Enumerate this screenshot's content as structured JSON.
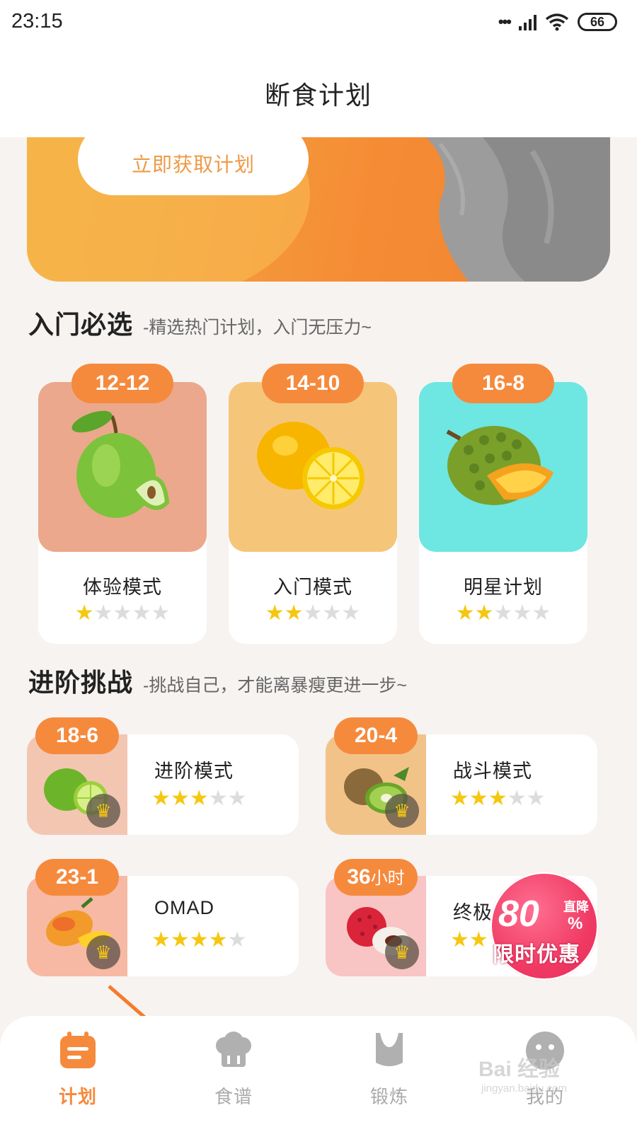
{
  "status_bar": {
    "time": "23:15",
    "battery": "66",
    "signal_dots": "•••"
  },
  "header": {
    "title": "断食计划"
  },
  "banner": {
    "button_label": "立即获取计划"
  },
  "beginner": {
    "title": "入门必选",
    "subtitle": "-精选热门计划，入门无压力~",
    "cards": [
      {
        "badge": "12-12",
        "label": "体验模式",
        "rating": 1,
        "max_rating": 5,
        "fruit": "green-apple",
        "bg": "#eba88c"
      },
      {
        "badge": "14-10",
        "label": "入门模式",
        "rating": 2,
        "max_rating": 5,
        "fruit": "lemon",
        "bg": "#f5c67a"
      },
      {
        "badge": "16-8",
        "label": "明星计划",
        "rating": 2,
        "max_rating": 5,
        "fruit": "durian",
        "bg": "#6ee6e2"
      }
    ]
  },
  "advanced": {
    "title": "进阶挑战",
    "subtitle": "-挑战自己，才能离暴瘦更进一步~",
    "cards": [
      {
        "badge": "18-6",
        "label": "进阶模式",
        "rating": 3,
        "max_rating": 5,
        "fruit": "lime",
        "bg": "#f3c6b2"
      },
      {
        "badge": "20-4",
        "label": "战斗模式",
        "rating": 3,
        "max_rating": 5,
        "fruit": "kiwi",
        "bg": "#f2c389"
      },
      {
        "badge": "23-1",
        "label": "OMAD",
        "rating": 4,
        "max_rating": 5,
        "fruit": "mango",
        "bg": "#f7b9a3"
      },
      {
        "badge_main": "36",
        "badge_unit": "小时",
        "label": "终极",
        "rating": 2,
        "max_rating": 5,
        "fruit": "lychee",
        "bg": "#f9c4c4"
      }
    ]
  },
  "promo": {
    "amount": "80",
    "tag": "直降",
    "unit": "%",
    "label": "限时优惠"
  },
  "tabbar": {
    "tabs": [
      {
        "label": "计划",
        "icon": "calendar-icon",
        "active": true
      },
      {
        "label": "食谱",
        "icon": "chef-hat-icon",
        "active": false
      },
      {
        "label": "锻炼",
        "icon": "sports-bra-icon",
        "active": false
      },
      {
        "label": "我的",
        "icon": "avatar-icon",
        "active": false
      }
    ]
  },
  "watermark": {
    "text": "Bai 经验",
    "sub": "jingyan.baidu.com"
  },
  "colors": {
    "accent": "#f58a3d",
    "star": "#f5c711",
    "star_off": "#dcdcdc"
  }
}
